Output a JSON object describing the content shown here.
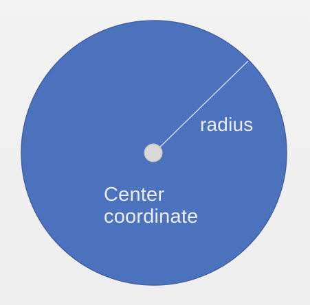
{
  "diagram": {
    "labels": {
      "radius": "radius",
      "center_line1": "Center",
      "center_line2": "coordinate"
    },
    "colors": {
      "circle_fill": "#4d72bd",
      "circle_stroke": "#41619f",
      "center_dot_fill": "#d9d9d9",
      "center_dot_stroke": "#bfbfbf",
      "radius_line": "#d7ddef",
      "text": "#e9edf7",
      "background": "#f0f0f0"
    }
  }
}
